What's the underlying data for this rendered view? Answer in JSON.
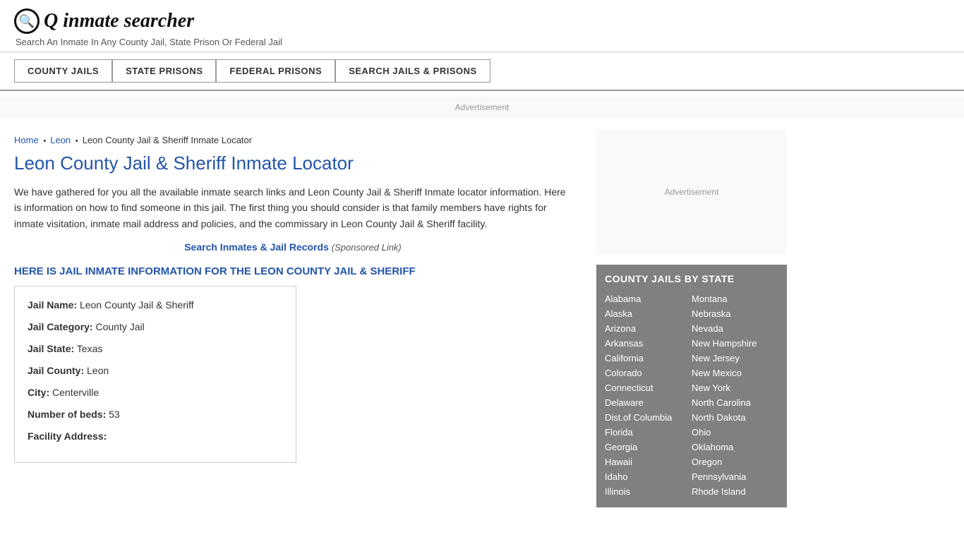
{
  "header": {
    "logo_icon": "🔍",
    "logo_text_bold": "inmate",
    "logo_text_normal": "searcher",
    "tagline": "Search An Inmate In Any County Jail, State Prison Or Federal Jail"
  },
  "nav": {
    "buttons": [
      {
        "label": "COUNTY JAILS",
        "id": "county-jails"
      },
      {
        "label": "STATE PRISONS",
        "id": "state-prisons"
      },
      {
        "label": "FEDERAL PRISONS",
        "id": "federal-prisons"
      },
      {
        "label": "SEARCH JAILS & PRISONS",
        "id": "search-jails"
      }
    ]
  },
  "breadcrumb": {
    "home": "Home",
    "parent": "Leon",
    "current": "Leon County Jail & Sheriff Inmate Locator"
  },
  "page": {
    "title": "Leon County Jail & Sheriff Inmate Locator",
    "description": "We have gathered for you all the available inmate search links and Leon County Jail & Sheriff Inmate locator information. Here is information on how to find someone in this jail. The first thing you should consider is that family members have rights for inmate visitation, inmate mail address and policies, and the commissary in Leon County Jail & Sheriff facility.",
    "sponsored_link_text": "Search Inmates & Jail Records",
    "sponsored_note": "(Sponsored Link)",
    "info_heading": "HERE IS JAIL INMATE INFORMATION FOR THE LEON COUNTY JAIL & SHERIFF"
  },
  "jail_info": {
    "name_label": "Jail Name:",
    "name_value": "Leon County Jail & Sheriff",
    "category_label": "Jail Category:",
    "category_value": "County Jail",
    "state_label": "Jail State:",
    "state_value": "Texas",
    "county_label": "Jail County:",
    "county_value": "Leon",
    "city_label": "City:",
    "city_value": "Centerville",
    "beds_label": "Number of beds:",
    "beds_value": "53",
    "address_label": "Facility Address:"
  },
  "sidebar": {
    "ad_text": "Advertisement",
    "county_by_state_title": "COUNTY JAILS BY STATE",
    "states_left": [
      "Alabama",
      "Alaska",
      "Arizona",
      "Arkansas",
      "California",
      "Colorado",
      "Connecticut",
      "Delaware",
      "Dist.of Columbia",
      "Florida",
      "Georgia",
      "Hawaii",
      "Idaho",
      "Illinois"
    ],
    "states_right": [
      "Montana",
      "Nebraska",
      "Nevada",
      "New Hampshire",
      "New Jersey",
      "New Mexico",
      "New York",
      "North Carolina",
      "North Dakota",
      "Ohio",
      "Oklahoma",
      "Oregon",
      "Pennsylvania",
      "Rhode Island"
    ]
  },
  "ad": {
    "top_text": "Advertisement",
    "sidebar_text": "Advertisement"
  }
}
